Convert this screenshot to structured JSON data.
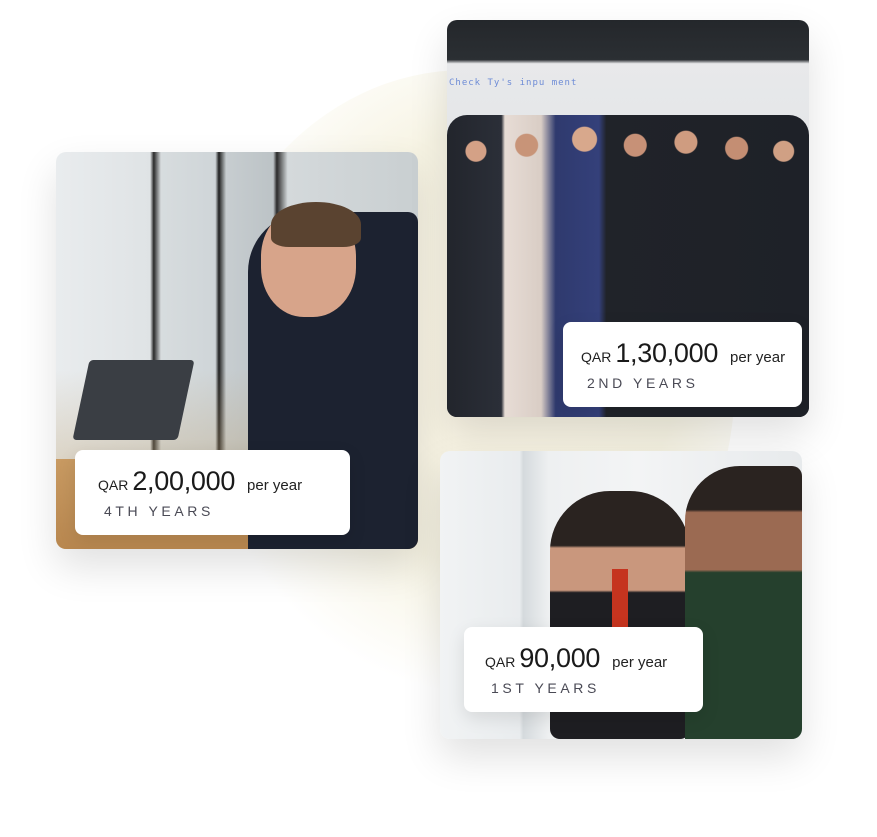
{
  "cards": [
    {
      "currency": "QAR",
      "amount": "2,00,000",
      "period": "per year",
      "years": "4TH YEARS",
      "image": "man-working-on-laptop-photo"
    },
    {
      "currency": "QAR",
      "amount": "1,30,000",
      "period": "per year",
      "years": "2ND YEARS",
      "image": "group-celebration-photo",
      "screen_text": "Check Ty's inpu   ment"
    },
    {
      "currency": "QAR",
      "amount": "90,000",
      "period": "per year",
      "years": "1ST YEARS",
      "image": "trophy-handover-photo"
    }
  ],
  "colors": {
    "background": "#ffffff",
    "blob": "#f7f4e4",
    "card_text": "#1a1a1a",
    "years_text": "#4a4a55"
  }
}
